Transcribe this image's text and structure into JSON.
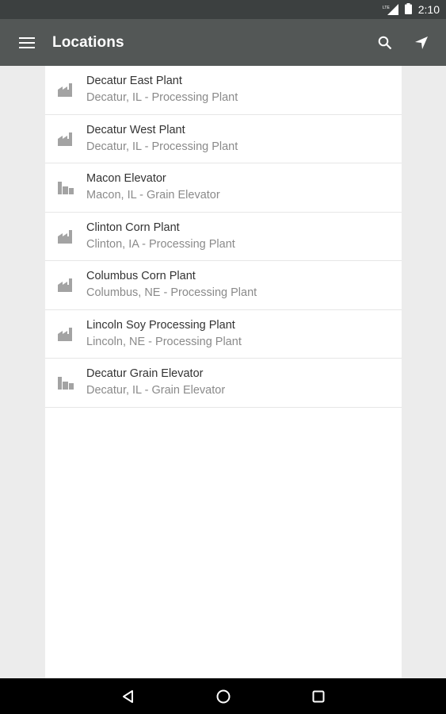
{
  "status_bar": {
    "network": "LTE",
    "time": "2:10"
  },
  "app_bar": {
    "title": "Locations",
    "menu_icon": "hamburger-menu-icon",
    "actions": [
      {
        "name": "search",
        "icon": "search-icon"
      },
      {
        "name": "my-location",
        "icon": "navigation-arrow-icon"
      }
    ]
  },
  "locations": [
    {
      "name": "Decatur East Plant",
      "subtitle": "Decatur, IL - Processing Plant",
      "icon": "factory-icon"
    },
    {
      "name": "Decatur West Plant",
      "subtitle": "Decatur, IL - Processing Plant",
      "icon": "factory-icon"
    },
    {
      "name": "Macon Elevator",
      "subtitle": "Macon, IL - Grain Elevator",
      "icon": "grain-elevator-icon"
    },
    {
      "name": "Clinton Corn Plant",
      "subtitle": "Clinton, IA - Processing Plant",
      "icon": "factory-icon"
    },
    {
      "name": "Columbus Corn Plant",
      "subtitle": "Columbus, NE - Processing Plant",
      "icon": "factory-icon"
    },
    {
      "name": "Lincoln Soy Processing Plant",
      "subtitle": "Lincoln, NE - Processing Plant",
      "icon": "factory-icon"
    },
    {
      "name": "Decatur Grain Elevator",
      "subtitle": "Decatur, IL - Grain Elevator",
      "icon": "grain-elevator-icon"
    }
  ],
  "nav_bar": {
    "buttons": [
      "back-icon",
      "home-icon",
      "recents-icon"
    ]
  },
  "colors": {
    "status_bar": "#3c4040",
    "app_bar": "#535756",
    "background": "#ececec",
    "icon_gray": "#a3a3a3"
  }
}
